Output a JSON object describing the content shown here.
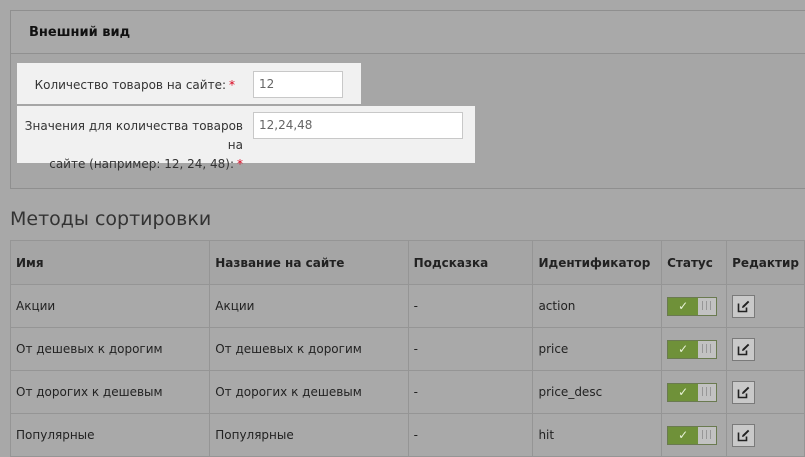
{
  "appearance": {
    "title": "Внешний вид",
    "products_count": {
      "label": "Количество товаров на сайте:",
      "required_mark": "*",
      "value": "12"
    },
    "count_values": {
      "label_line1": "Значения для количества товаров на",
      "label_line2": "сайте (например: 12, 24, 48):",
      "required_mark": "*",
      "value": "12,24,48"
    }
  },
  "sorting": {
    "title": "Методы сортировки",
    "columns": [
      "Имя",
      "Название на сайте",
      "Подсказка",
      "Идентификатор",
      "Статус",
      "Редактир"
    ],
    "rows": [
      {
        "name": "Акции",
        "site_name": "Акции",
        "hint": "-",
        "identifier": "action"
      },
      {
        "name": "От дешевых к дорогим",
        "site_name": "От дешевых к дорогим",
        "hint": "-",
        "identifier": "price"
      },
      {
        "name": "От дорогих к дешевым",
        "site_name": "От дорогих к дешевым",
        "hint": "-",
        "identifier": "price_desc"
      },
      {
        "name": "Популярные",
        "site_name": "Популярные",
        "hint": "-",
        "identifier": "hit"
      }
    ],
    "status_on_icon": "check-icon",
    "status_off_icon": "bars-icon",
    "edit_icon": "edit-icon"
  },
  "colors": {
    "toggle_on": "#6f9139",
    "required": "#d9001b"
  }
}
